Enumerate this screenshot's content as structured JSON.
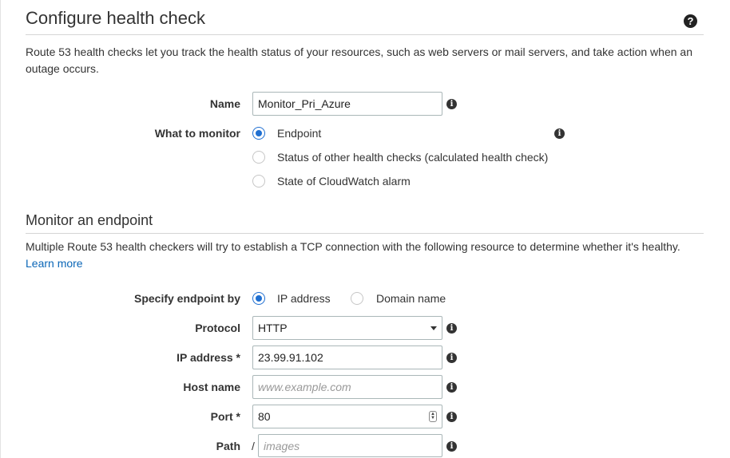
{
  "header": {
    "title": "Configure health check",
    "description": "Route 53 health checks let you track the health status of your resources, such as web servers or mail servers, and take action when an outage occurs."
  },
  "form": {
    "name_label": "Name",
    "name_value": "Monitor_Pri_Azure",
    "monitor_label": "What to monitor",
    "monitor_options": [
      {
        "label": "Endpoint",
        "selected": true
      },
      {
        "label": "Status of other health checks (calculated health check)",
        "selected": false
      },
      {
        "label": "State of CloudWatch alarm",
        "selected": false
      }
    ]
  },
  "endpoint_section": {
    "title": "Monitor an endpoint",
    "description": "Multiple Route 53 health checkers will try to establish a TCP connection with the following resource to determine whether it's healthy.",
    "learn_more": "Learn more",
    "specify_label": "Specify endpoint by",
    "specify_options": [
      {
        "label": "IP address",
        "selected": true
      },
      {
        "label": "Domain name",
        "selected": false
      }
    ],
    "protocol_label": "Protocol",
    "protocol_value": "HTTP",
    "ip_label": "IP address *",
    "ip_value": "23.99.91.102",
    "host_label": "Host name",
    "host_placeholder": "www.example.com",
    "port_label": "Port *",
    "port_value": "80",
    "path_label": "Path",
    "path_prefix": "/",
    "path_placeholder": "images"
  },
  "icons": {
    "help": "question-circle-icon",
    "info": "info-circle-icon"
  },
  "colors": {
    "accent": "#1f6fd1",
    "link": "#0a66b7",
    "text": "#333333"
  }
}
